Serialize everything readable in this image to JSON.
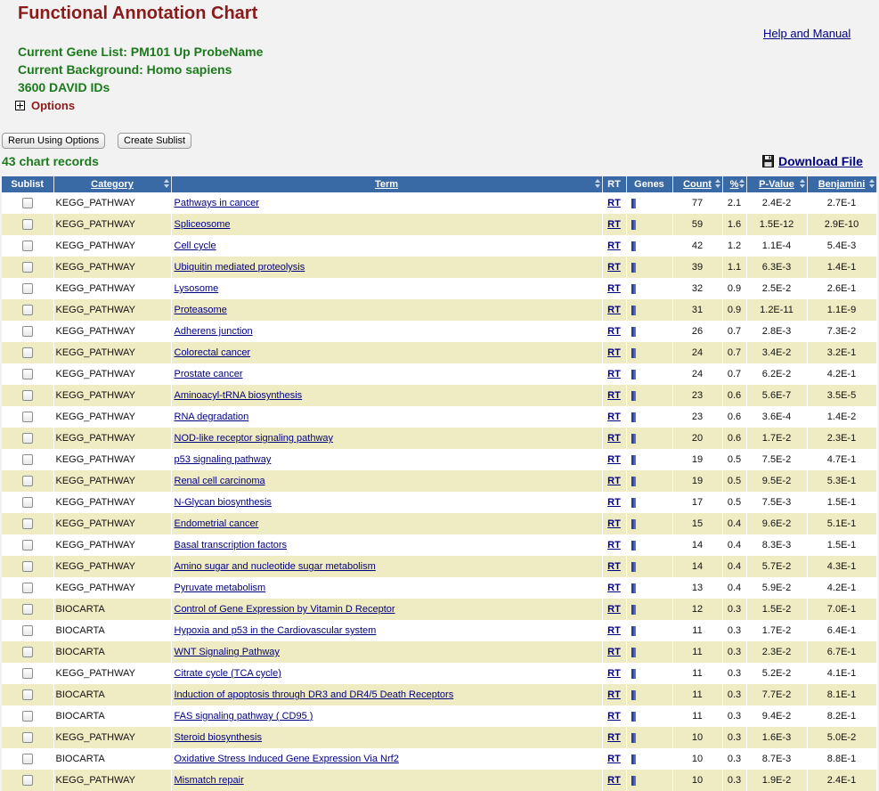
{
  "header": {
    "title": "Functional Annotation Chart",
    "help_link": "Help and Manual",
    "gene_list": "Current Gene List: PM101 Up ProbeName",
    "background": "Current Background: Homo sapiens",
    "david_ids": "3600 DAVID IDs",
    "options_label": "Options"
  },
  "toolbar": {
    "rerun_label": "Rerun Using Options",
    "sublist_label": "Create Sublist",
    "records_label": "43 chart records",
    "download_label": "Download File"
  },
  "table": {
    "columns": [
      "Sublist",
      "Category",
      "Term",
      "RT",
      "Genes",
      "Count",
      "%",
      "P-Value",
      "Benjamini"
    ],
    "rt_label": "RT",
    "rows": [
      {
        "category": "KEGG_PATHWAY",
        "term": "Pathways in cancer",
        "count": "77",
        "percent": "2.1",
        "pvalue": "2.4E-2",
        "benjamini": "2.7E-1"
      },
      {
        "category": "KEGG_PATHWAY",
        "term": "Spliceosome",
        "count": "59",
        "percent": "1.6",
        "pvalue": "1.5E-12",
        "benjamini": "2.9E-10"
      },
      {
        "category": "KEGG_PATHWAY",
        "term": "Cell cycle",
        "count": "42",
        "percent": "1.2",
        "pvalue": "1.1E-4",
        "benjamini": "5.4E-3"
      },
      {
        "category": "KEGG_PATHWAY",
        "term": "Ubiquitin mediated proteolysis",
        "count": "39",
        "percent": "1.1",
        "pvalue": "6.3E-3",
        "benjamini": "1.4E-1"
      },
      {
        "category": "KEGG_PATHWAY",
        "term": "Lysosome",
        "count": "32",
        "percent": "0.9",
        "pvalue": "2.5E-2",
        "benjamini": "2.6E-1"
      },
      {
        "category": "KEGG_PATHWAY",
        "term": "Proteasome",
        "count": "31",
        "percent": "0.9",
        "pvalue": "1.2E-11",
        "benjamini": "1.1E-9"
      },
      {
        "category": "KEGG_PATHWAY",
        "term": "Adherens junction",
        "count": "26",
        "percent": "0.7",
        "pvalue": "2.8E-3",
        "benjamini": "7.3E-2"
      },
      {
        "category": "KEGG_PATHWAY",
        "term": "Colorectal cancer",
        "count": "24",
        "percent": "0.7",
        "pvalue": "3.4E-2",
        "benjamini": "3.2E-1"
      },
      {
        "category": "KEGG_PATHWAY",
        "term": "Prostate cancer",
        "count": "24",
        "percent": "0.7",
        "pvalue": "6.2E-2",
        "benjamini": "4.2E-1"
      },
      {
        "category": "KEGG_PATHWAY",
        "term": "Aminoacyl-tRNA biosynthesis",
        "count": "23",
        "percent": "0.6",
        "pvalue": "5.6E-7",
        "benjamini": "3.5E-5"
      },
      {
        "category": "KEGG_PATHWAY",
        "term": "RNA degradation",
        "count": "23",
        "percent": "0.6",
        "pvalue": "3.6E-4",
        "benjamini": "1.4E-2"
      },
      {
        "category": "KEGG_PATHWAY",
        "term": "NOD-like receptor signaling pathway",
        "count": "20",
        "percent": "0.6",
        "pvalue": "1.7E-2",
        "benjamini": "2.3E-1"
      },
      {
        "category": "KEGG_PATHWAY",
        "term": "p53 signaling pathway",
        "count": "19",
        "percent": "0.5",
        "pvalue": "7.5E-2",
        "benjamini": "4.7E-1"
      },
      {
        "category": "KEGG_PATHWAY",
        "term": "Renal cell carcinoma",
        "count": "19",
        "percent": "0.5",
        "pvalue": "9.5E-2",
        "benjamini": "5.3E-1"
      },
      {
        "category": "KEGG_PATHWAY",
        "term": "N-Glycan biosynthesis",
        "count": "17",
        "percent": "0.5",
        "pvalue": "7.5E-3",
        "benjamini": "1.5E-1"
      },
      {
        "category": "KEGG_PATHWAY",
        "term": "Endometrial cancer",
        "count": "15",
        "percent": "0.4",
        "pvalue": "9.6E-2",
        "benjamini": "5.1E-1"
      },
      {
        "category": "KEGG_PATHWAY",
        "term": "Basal transcription factors",
        "count": "14",
        "percent": "0.4",
        "pvalue": "8.3E-3",
        "benjamini": "1.5E-1"
      },
      {
        "category": "KEGG_PATHWAY",
        "term": "Amino sugar and nucleotide sugar metabolism",
        "count": "14",
        "percent": "0.4",
        "pvalue": "5.7E-2",
        "benjamini": "4.3E-1"
      },
      {
        "category": "KEGG_PATHWAY",
        "term": "Pyruvate metabolism",
        "count": "13",
        "percent": "0.4",
        "pvalue": "5.9E-2",
        "benjamini": "4.2E-1"
      },
      {
        "category": "BIOCARTA",
        "term": "Control of Gene Expression by Vitamin D Receptor",
        "count": "12",
        "percent": "0.3",
        "pvalue": "1.5E-2",
        "benjamini": "7.0E-1"
      },
      {
        "category": "BIOCARTA",
        "term": "Hypoxia and p53 in the Cardiovascular system",
        "count": "11",
        "percent": "0.3",
        "pvalue": "1.7E-2",
        "benjamini": "6.4E-1"
      },
      {
        "category": "BIOCARTA",
        "term": "WNT Signaling Pathway",
        "count": "11",
        "percent": "0.3",
        "pvalue": "2.3E-2",
        "benjamini": "6.7E-1"
      },
      {
        "category": "KEGG_PATHWAY",
        "term": "Citrate cycle (TCA cycle)",
        "count": "11",
        "percent": "0.3",
        "pvalue": "5.2E-2",
        "benjamini": "4.1E-1"
      },
      {
        "category": "BIOCARTA",
        "term": "Induction of apoptosis through DR3 and DR4/5 Death Receptors",
        "count": "11",
        "percent": "0.3",
        "pvalue": "7.7E-2",
        "benjamini": "8.1E-1"
      },
      {
        "category": "BIOCARTA",
        "term": "FAS signaling pathway ( CD95 )",
        "count": "11",
        "percent": "0.3",
        "pvalue": "9.4E-2",
        "benjamini": "8.2E-1"
      },
      {
        "category": "KEGG_PATHWAY",
        "term": "Steroid biosynthesis",
        "count": "10",
        "percent": "0.3",
        "pvalue": "1.6E-3",
        "benjamini": "5.0E-2"
      },
      {
        "category": "BIOCARTA",
        "term": "Oxidative Stress Induced Gene Expression Via Nrf2",
        "count": "10",
        "percent": "0.3",
        "pvalue": "8.7E-3",
        "benjamini": "8.8E-1"
      },
      {
        "category": "KEGG_PATHWAY",
        "term": "Mismatch repair",
        "count": "10",
        "percent": "0.3",
        "pvalue": "1.9E-2",
        "benjamini": "2.4E-1"
      }
    ]
  }
}
